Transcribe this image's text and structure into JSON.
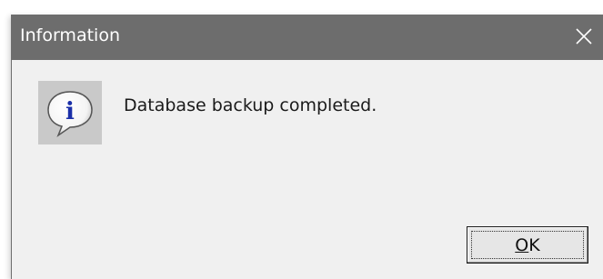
{
  "dialog": {
    "title": "Information",
    "message": "Database backup completed.",
    "icon": "info-speech-bubble-icon",
    "close_icon": "close-icon"
  },
  "buttons": {
    "ok_mnemonic": "O",
    "ok_rest": "K"
  },
  "colors": {
    "titlebar": "#6d6d6d",
    "dialog_bg": "#f0f0f0",
    "icon_bg": "#c9c9c9",
    "info_blue": "#1a2fa8"
  }
}
